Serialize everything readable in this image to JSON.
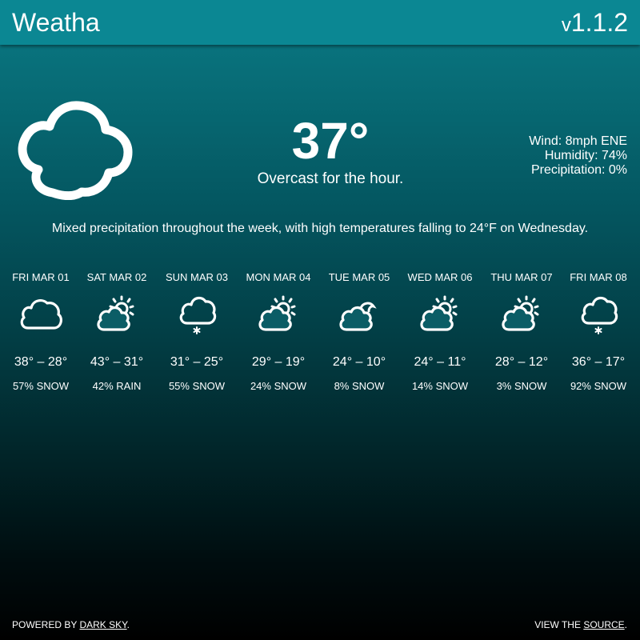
{
  "header": {
    "title": "Weatha",
    "version_prefix": "v",
    "version": "1.1.2"
  },
  "current": {
    "icon": "cloud-icon",
    "temperature": "37°",
    "summary": "Overcast for the hour.",
    "wind": "Wind: 8mph ENE",
    "humidity": "Humidity: 74%",
    "precipitation": "Precipitation: 0%"
  },
  "week_summary": "Mixed precipitation throughout the week, with high temperatures falling to 24°F on Wednesday.",
  "forecast": [
    {
      "label": "FRI MAR 01",
      "icon": "cloud-icon",
      "temps": "38° – 28°",
      "precip": "57% SNOW"
    },
    {
      "label": "SAT MAR 02",
      "icon": "partly-cloudy-day-icon",
      "temps": "43° – 31°",
      "precip": "42% RAIN"
    },
    {
      "label": "SUN MAR 03",
      "icon": "snow-icon",
      "temps": "31° – 25°",
      "precip": "55% SNOW"
    },
    {
      "label": "MON MAR 04",
      "icon": "partly-cloudy-day-icon",
      "temps": "29° – 19°",
      "precip": "24% SNOW"
    },
    {
      "label": "TUE MAR 05",
      "icon": "partly-cloudy-night-icon",
      "temps": "24° – 10°",
      "precip": "8% SNOW"
    },
    {
      "label": "WED MAR 06",
      "icon": "partly-cloudy-day-icon",
      "temps": "24° – 11°",
      "precip": "14% SNOW"
    },
    {
      "label": "THU MAR 07",
      "icon": "partly-cloudy-day-icon",
      "temps": "28° – 12°",
      "precip": "3% SNOW"
    },
    {
      "label": "FRI MAR 08",
      "icon": "snow-icon",
      "temps": "36° – 17°",
      "precip": "92% SNOW"
    }
  ],
  "footer": {
    "powered_prefix": "POWERED BY ",
    "powered_link": "DARK SKY",
    "powered_suffix": ".",
    "source_prefix": "VIEW THE ",
    "source_link": "SOURCE",
    "source_suffix": "."
  }
}
